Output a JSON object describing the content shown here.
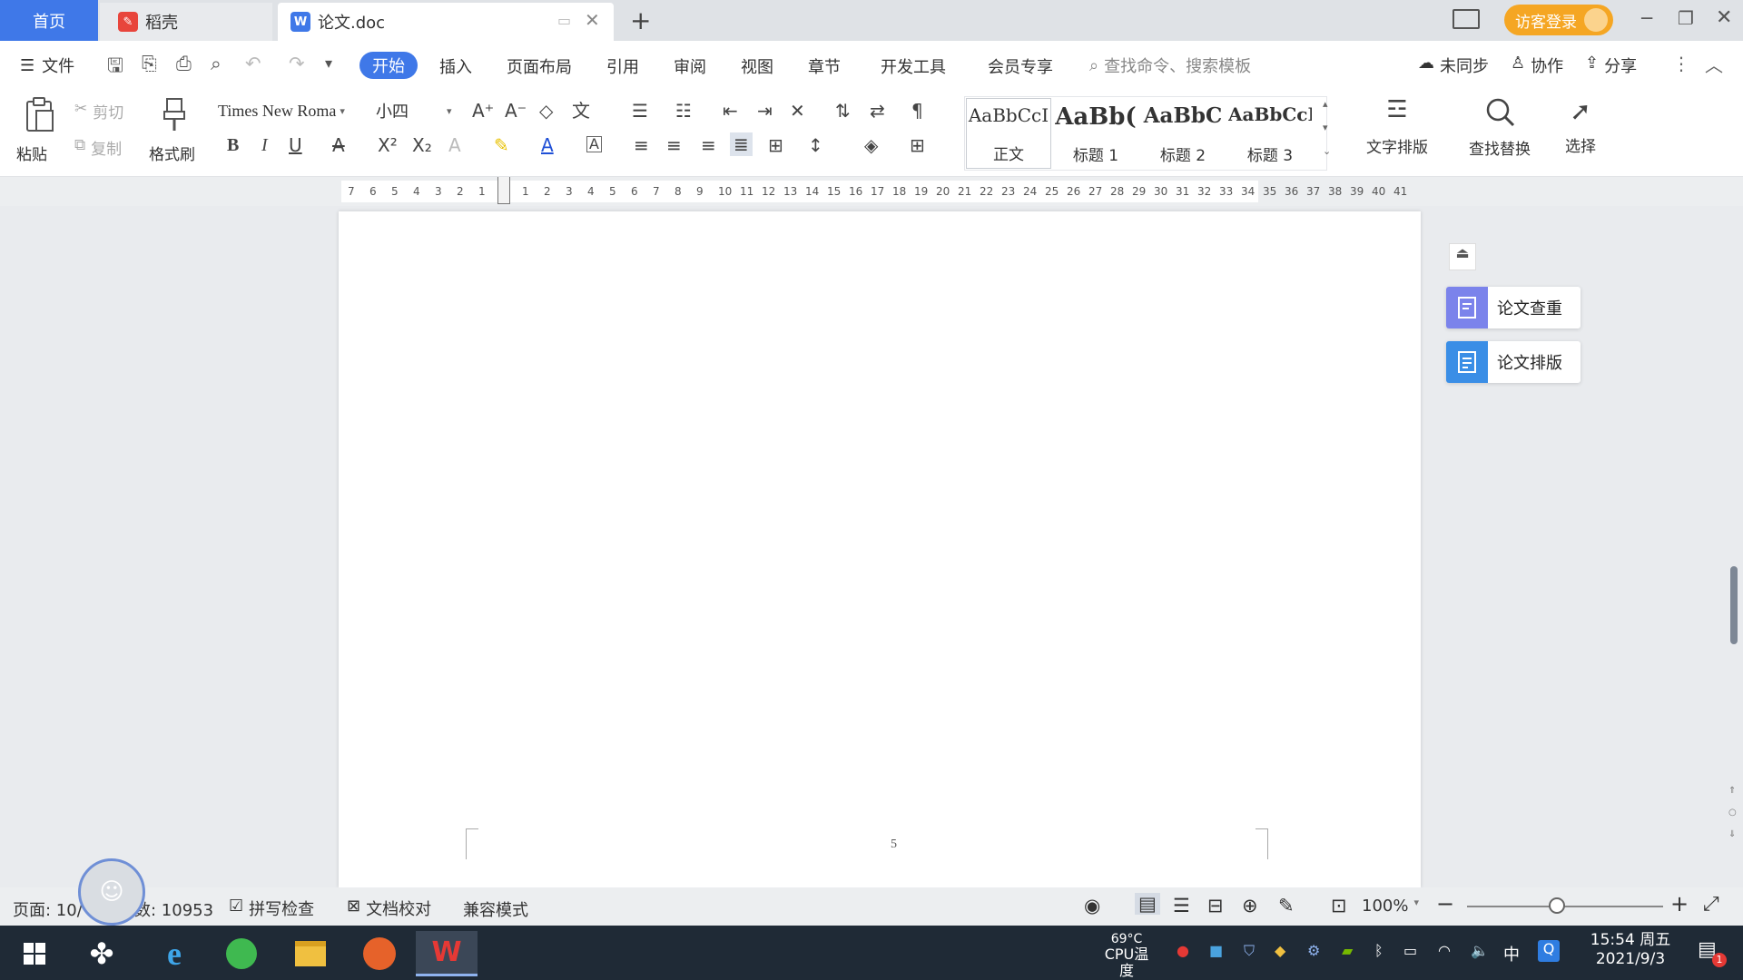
{
  "titlebar": {
    "tabs": [
      {
        "label": "首页"
      },
      {
        "label": "稻壳"
      },
      {
        "label": "论文.doc"
      }
    ],
    "login_label": "访客登录"
  },
  "menubar": {
    "file_label": "文件",
    "tabs": [
      "开始",
      "插入",
      "页面布局",
      "引用",
      "审阅",
      "视图",
      "章节",
      "开发工具",
      "会员专享"
    ],
    "active_tab": "开始",
    "search_placeholder": "查找命令、搜索模板",
    "sync_label": "未同步",
    "collab_label": "协作",
    "share_label": "分享"
  },
  "ribbon": {
    "paste_label": "粘贴",
    "cut_label": "剪切",
    "copy_label": "复制",
    "format_painter_label": "格式刷",
    "font_name": "Times New Roma",
    "font_size": "小四",
    "styles": [
      {
        "preview": "AaBbCcI",
        "name": "正文"
      },
      {
        "preview": "AaBb(",
        "name": "标题 1"
      },
      {
        "preview": "AaBbC",
        "name": "标题 2"
      },
      {
        "preview": "AaBbCcI",
        "name": "标题 3"
      }
    ],
    "text_layout_label": "文字排版",
    "find_replace_label": "查找替换",
    "select_label": "选择"
  },
  "ruler": {
    "left_ticks": [
      "7",
      "6",
      "5",
      "4",
      "3",
      "2",
      "1"
    ],
    "right_ticks": [
      "1",
      "2",
      "3",
      "4",
      "5",
      "6",
      "7",
      "8",
      "9",
      "10",
      "11",
      "12",
      "13",
      "14",
      "15",
      "16",
      "17",
      "18",
      "19",
      "20",
      "21",
      "22",
      "23",
      "24",
      "25",
      "26",
      "27",
      "28",
      "29",
      "30",
      "31",
      "32",
      "33",
      "34",
      "35",
      "36",
      "37",
      "38",
      "39",
      "40",
      "41"
    ]
  },
  "page": {
    "page_number": "5"
  },
  "right_panel": {
    "buttons": [
      {
        "label": "论文查重",
        "color": "#7b83eb"
      },
      {
        "label": "论文排版",
        "color": "#3a8ee6"
      }
    ]
  },
  "statusbar": {
    "page_info": "页面: 10/",
    "word_count": "数: 10953",
    "spell_check": "拼写检查",
    "doc_proof": "文档校对",
    "compat_mode": "兼容模式",
    "zoom": "100%"
  },
  "taskbar": {
    "cpu_temp": "69°C",
    "cpu_label": "CPU温度",
    "ime": "中",
    "time": "15:54 周五",
    "date": "2021/9/3",
    "notification_count": "1"
  },
  "colors": {
    "accent": "#3f78e8",
    "login": "#f5a623"
  }
}
